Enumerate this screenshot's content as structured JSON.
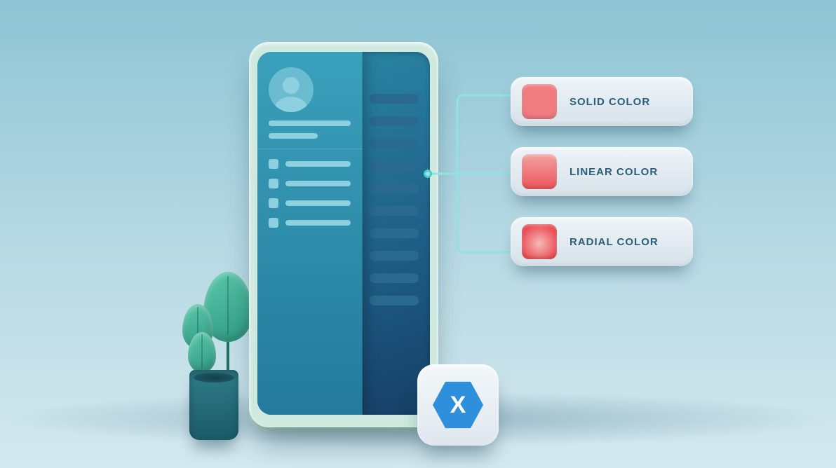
{
  "options": {
    "solid": {
      "label": "SOLID COLOR"
    },
    "linear": {
      "label": "LINEAR COLOR"
    },
    "radial": {
      "label": "RADIAL COLOR"
    }
  },
  "logo": {
    "glyph": "X"
  }
}
